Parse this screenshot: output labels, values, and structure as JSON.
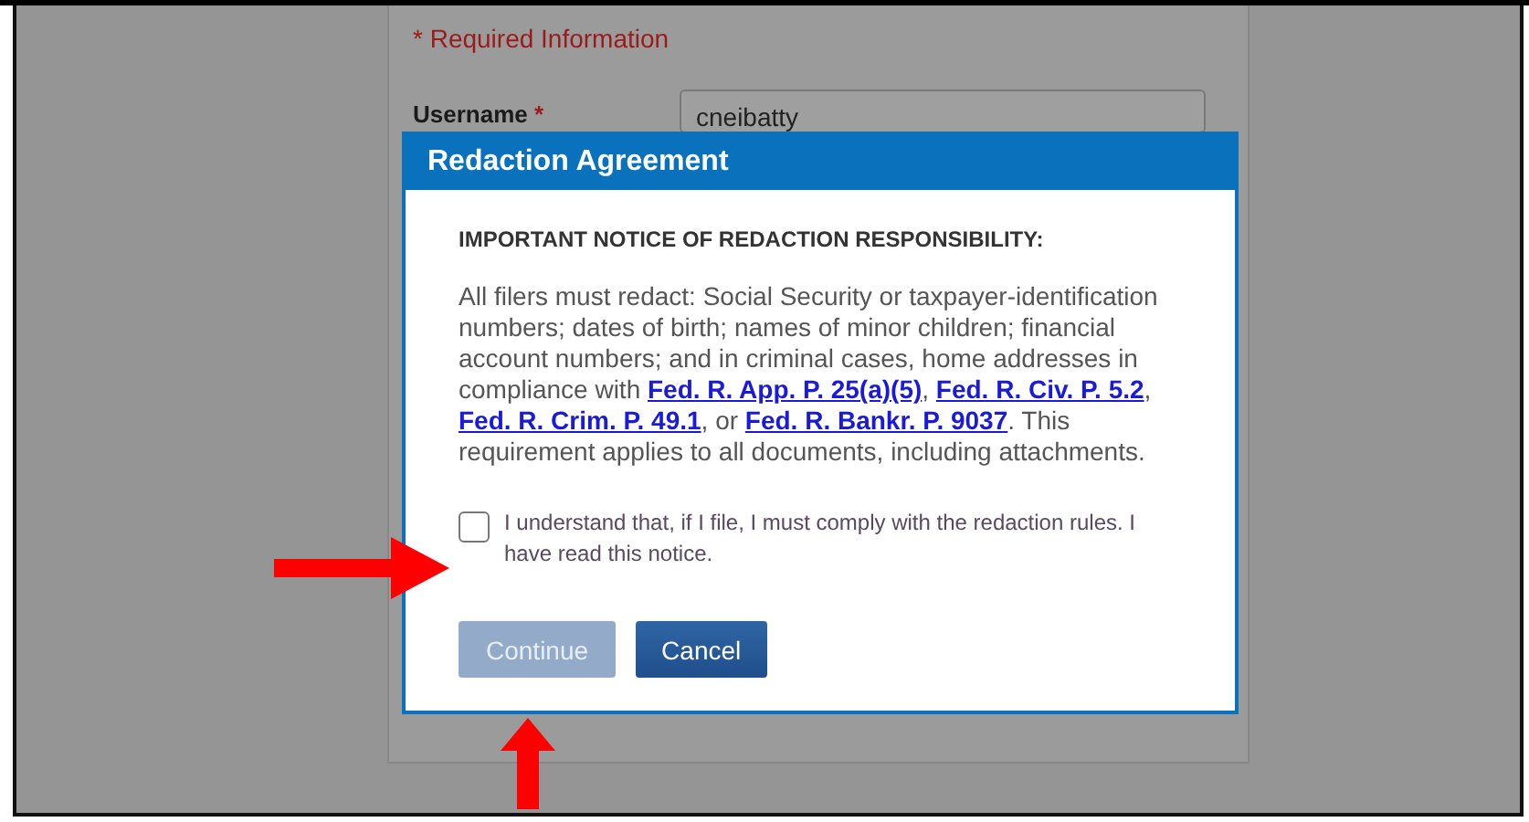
{
  "page": {
    "required_note": "* Required Information",
    "username_label": "Username",
    "required_mark": "*",
    "username_value": "cneibatty"
  },
  "dialog": {
    "title": "Redaction Agreement",
    "notice_heading": "IMPORTANT NOTICE OF REDACTION RESPONSIBILITY:",
    "notice_parts": [
      {
        "kind": "text",
        "text": "All filers must redact: Social Security or taxpayer-identification numbers; dates of birth; names of minor children; financial account numbers; and in criminal cases, home addresses in compliance with "
      },
      {
        "kind": "link",
        "text": "Fed. R. App. P. 25(a)(5)"
      },
      {
        "kind": "text",
        "text": ", "
      },
      {
        "kind": "link",
        "text": "Fed. R. Civ. P. 5.2"
      },
      {
        "kind": "text",
        "text": ", "
      },
      {
        "kind": "link",
        "text": "Fed. R. Crim. P. 49.1"
      },
      {
        "kind": "text",
        "text": ", or "
      },
      {
        "kind": "link",
        "text": "Fed. R. Bankr. P. 9037"
      },
      {
        "kind": "text",
        "text": ". This requirement applies to all documents, including attachments."
      }
    ],
    "agreement": {
      "label": "I understand that, if I file, I must comply with the redaction rules. I have read this notice.",
      "checked": false
    },
    "buttons": [
      {
        "label": "Continue",
        "disabled": true
      },
      {
        "label": "Cancel",
        "disabled": false
      }
    ]
  }
}
